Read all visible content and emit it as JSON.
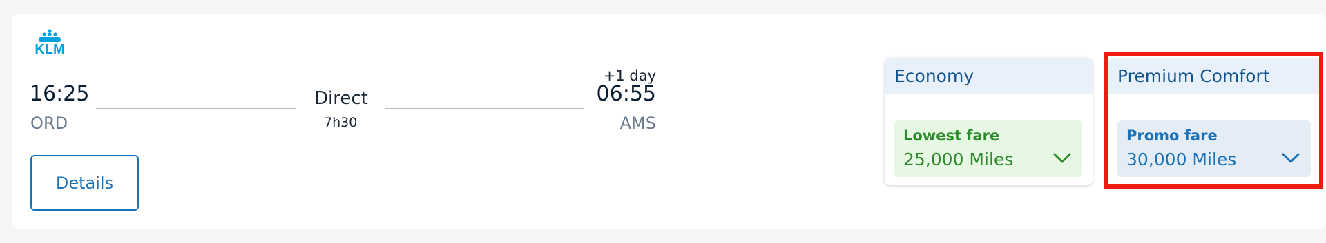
{
  "airline": {
    "logo_text": "KLM"
  },
  "flight": {
    "departure_time": "16:25",
    "departure_airport": "ORD",
    "stops": "Direct",
    "duration": "7h30",
    "arrival_day_offset": "+1 day",
    "arrival_time": "06:55",
    "arrival_airport": "AMS"
  },
  "details_button": {
    "label": "Details"
  },
  "fares": [
    {
      "cabin": "Economy",
      "fare_type": "Lowest fare",
      "price": "25,000 Miles",
      "accent_color": "#2d8a2a"
    },
    {
      "cabin": "Premium Comfort",
      "fare_type": "Promo fare",
      "price": "30,000 Miles",
      "accent_color": "#1a71b8"
    }
  ],
  "colors": {
    "brand_blue": "#00a1de",
    "link_blue": "#1a71b8",
    "highlight_red": "#f01b0f"
  }
}
